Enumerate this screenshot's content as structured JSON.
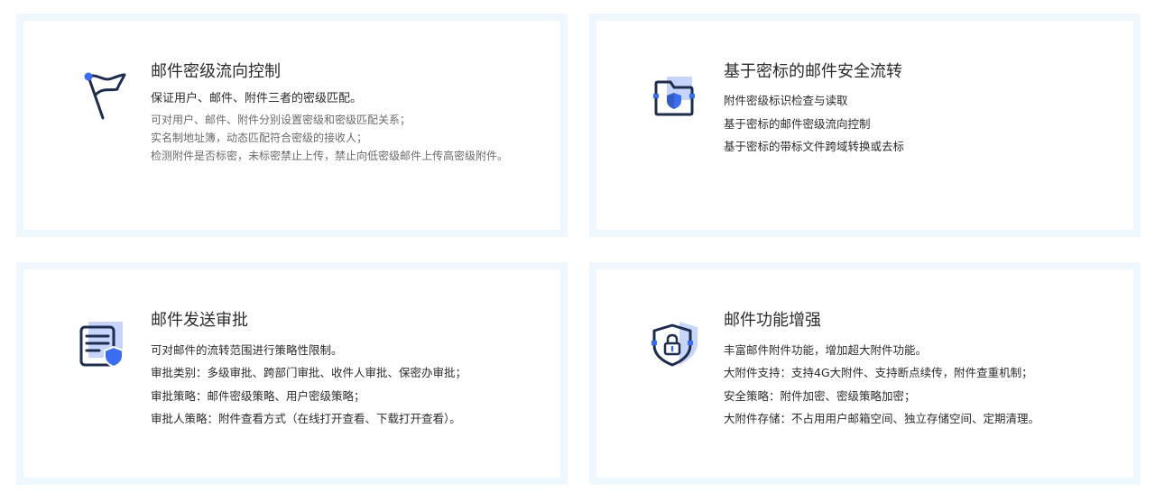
{
  "colors": {
    "card_border": "#eef7fd",
    "icon_navy": "#1f2d4d",
    "icon_blue": "#3a6df0",
    "icon_light": "#c7d4fb",
    "title_text": "#2b2b2b",
    "muted_text": "#6b6b6b"
  },
  "cards": [
    {
      "icon": "flag-icon",
      "title": "邮件密级流向控制",
      "lead": "保证用户、邮件、附件三者的密级匹配。",
      "lines": [
        "可对用户、邮件、附件分别设置密级和密级匹配关系；",
        "实名制地址簿，动态匹配符合密级的接收人；",
        "检测附件是否标密，未标密禁止上传，禁止向低密级邮件上传高密级附件。"
      ]
    },
    {
      "icon": "secure-folder-icon",
      "title": "基于密标的邮件安全流转",
      "lead": "",
      "lines": [
        "附件密级标识检查与读取",
        "基于密标的邮件密级流向控制",
        "基于密标的带标文件跨域转换或去标"
      ]
    },
    {
      "icon": "document-shield-icon",
      "title": "邮件发送审批",
      "lead": "可对邮件的流转范围进行策略性限制。",
      "lines": [
        "审批类别：多级审批、跨部门审批、收件人审批、保密办审批；",
        "审批策略：邮件密级策略、用户密级策略；",
        "审批人策略：附件查看方式（在线打开查看、下载打开查看）。"
      ]
    },
    {
      "icon": "shield-lock-icon",
      "title": "邮件功能增强",
      "lead": "丰富邮件附件功能，增加超大附件功能。",
      "lines": [
        "大附件支持：支持4G大附件、支持断点续传，附件查重机制；",
        "安全策略：附件加密、密级策略加密；",
        "大附件存储：不占用用户邮箱空间、独立存储空间、定期清理。"
      ]
    }
  ]
}
